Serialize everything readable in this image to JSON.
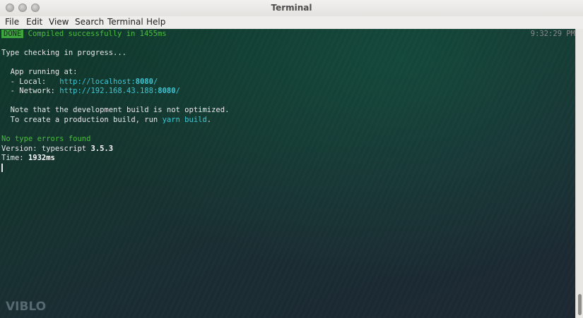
{
  "window": {
    "title": "Terminal"
  },
  "menu": [
    "File",
    "Edit",
    "View",
    "Search",
    "Terminal",
    "Help"
  ],
  "terminal": {
    "status_badge": "DONE",
    "compiled_msg": "Compiled successfully in 1455ms",
    "timestamp": "9:32:29 PM",
    "type_checking": "Type checking in progress...",
    "app_running": "  App running at:",
    "local_label": "  - Local:   ",
    "local_url_pre": "http://localhost:",
    "local_port": "8080",
    "local_url_post": "/",
    "network_label": "  - Network: ",
    "network_url_pre": "http://192.168.43.188:",
    "network_port": "8080",
    "network_url_post": "/",
    "note_line": "  Note that the development build is not optimized.",
    "prod_pre": "  To create a production build, run ",
    "prod_cmd": "yarn build",
    "prod_post": ".",
    "no_errors": "No type errors found",
    "version_label": "Version: typescript ",
    "version_value": "3.5.3",
    "time_label": "Time: ",
    "time_value": "1932ms"
  },
  "watermark": "VIBLO",
  "colors": {
    "badge": "#3fa63f",
    "green": "#4bbf3e",
    "cyan": "#3ec6d6"
  }
}
